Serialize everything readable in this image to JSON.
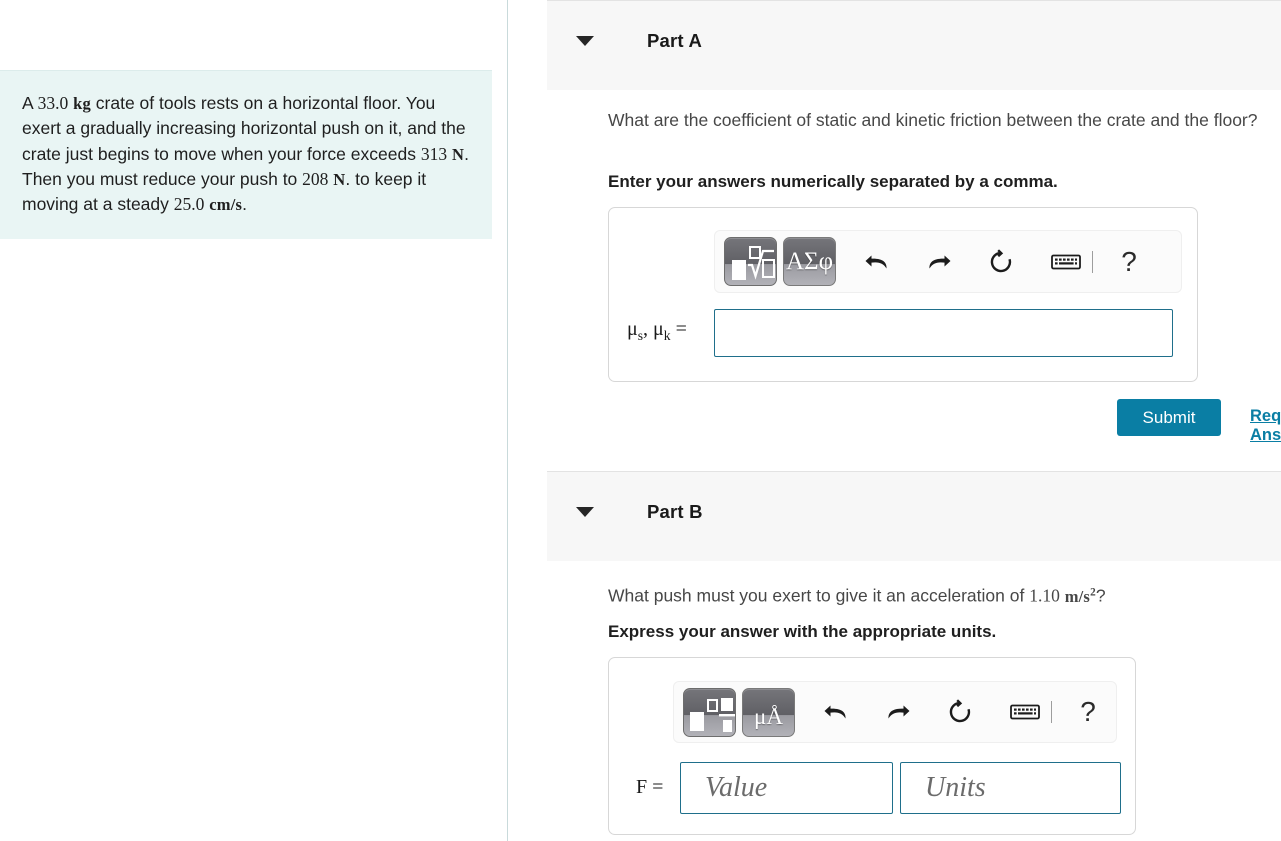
{
  "problem": {
    "text_segments": [
      {
        "t": "A ",
        "k": "plain"
      },
      {
        "t": "33.0",
        "k": "num"
      },
      {
        "t": " ",
        "k": "plain"
      },
      {
        "t": "kg",
        "k": "unit"
      },
      {
        "t": " crate of tools rests on a horizontal floor. You exert a gradually increasing horizontal push on it, and the crate just begins to move when your force exceeds ",
        "k": "plain"
      },
      {
        "t": "313",
        "k": "num"
      },
      {
        "t": " ",
        "k": "plain"
      },
      {
        "t": "N",
        "k": "unit"
      },
      {
        "t": ". Then you must reduce your push to ",
        "k": "plain"
      },
      {
        "t": "208",
        "k": "num"
      },
      {
        "t": " ",
        "k": "plain"
      },
      {
        "t": "N",
        "k": "unit"
      },
      {
        "t": ". to keep it moving at a steady ",
        "k": "plain"
      },
      {
        "t": "25.0",
        "k": "num"
      },
      {
        "t": " ",
        "k": "plain"
      },
      {
        "t": "cm/s",
        "k": "unit"
      },
      {
        "t": ".",
        "k": "plain"
      }
    ],
    "full_text": "A 33.0 kg crate of tools rests on a horizontal floor. You exert a gradually increasing horizontal push on it, and the crate just begins to move when your force exceeds 313 N. Then you must reduce your push to 208 N. to keep it moving at a steady 25.0 cm/s."
  },
  "part_a": {
    "title": "Part A",
    "caret": "collapse-caret-down",
    "question": "What are the coefficient of static and kinetic friction between the crate and the floor?",
    "instruction": "Enter your answers numerically separated by a comma.",
    "toolbar": {
      "template_button": "math-template-sqrt",
      "symbol_button": "ΑΣφ",
      "undo": "undo-icon",
      "redo": "redo-icon",
      "reset": "reset-icon",
      "keyboard": "keyboard-icon",
      "help": "?"
    },
    "answer_label_mu_s": "μ",
    "answer_label_sub_s": "s",
    "answer_label_mu_k": "μ",
    "answer_label_sub_k": "k",
    "answer_label_comma": ", ",
    "answer_label_equals": " =",
    "answer_value": "",
    "submit_label": "Submit",
    "request_answer_label": "Request Answer"
  },
  "part_b": {
    "title": "Part B",
    "caret": "collapse-caret-down",
    "question_pre": "What push must you exert to give it an acceleration of ",
    "question_value": "1.10",
    "question_unit_base": "m/s",
    "question_unit_exp": "2",
    "question_post": "?",
    "instruction": "Express your answer with the appropriate units.",
    "toolbar": {
      "template_button": "math-template-boxes",
      "units_button": "μÅ",
      "undo": "undo-icon",
      "redo": "redo-icon",
      "reset": "reset-icon",
      "keyboard": "keyboard-icon",
      "help": "?"
    },
    "field_label": "F =",
    "value_placeholder": "Value",
    "units_placeholder": "Units",
    "value": "",
    "units": ""
  },
  "colors": {
    "problem_bg": "#e9f5f4",
    "panel_divider": "#c9dadb",
    "part_header_bg": "#f7f7f7",
    "accent": "#0a7ea4",
    "field_border": "#1f6f8b",
    "box_border": "#d7d7d7"
  }
}
